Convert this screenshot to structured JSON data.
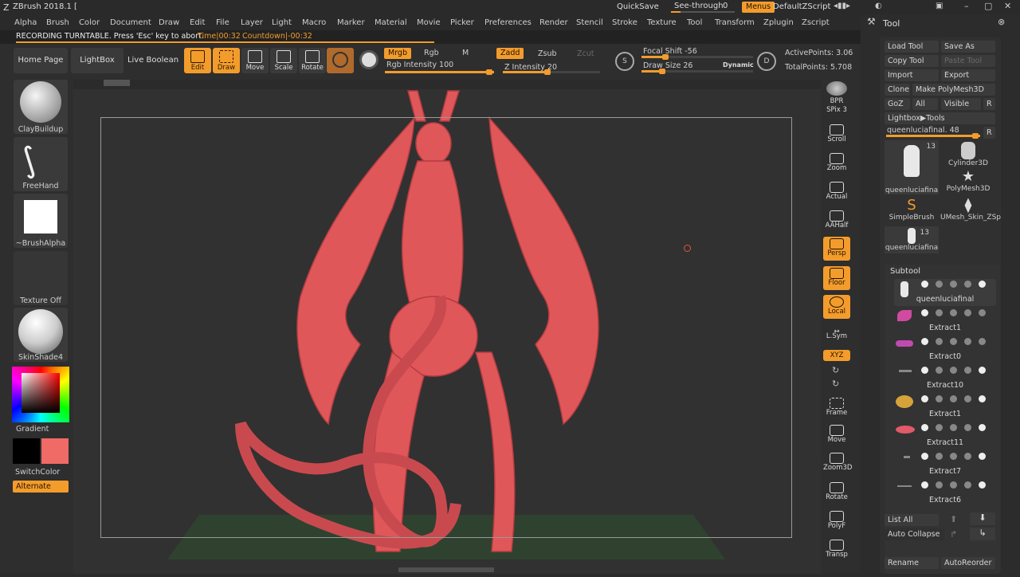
{
  "title_bar": {
    "app_title": "ZBrush 2018.1 [",
    "quicksave": "QuickSave",
    "see_through_label": "See-through",
    "see_through_value": "0",
    "menus": "Menus",
    "zscript": "DefaultZScript"
  },
  "menu": [
    "Alpha",
    "Brush",
    "Color",
    "Document",
    "Draw",
    "Edit",
    "File",
    "Layer",
    "Light",
    "Macro",
    "Marker",
    "Material",
    "Movie",
    "Picker",
    "Preferences",
    "Render",
    "Stencil",
    "Stroke",
    "Texture",
    "Tool",
    "Transform",
    "Zplugin",
    "Zscript"
  ],
  "recording": {
    "message": "RECORDING TURNTABLE. Press 'Esc' key to abort.",
    "time": "Time|00:32",
    "countdown": "Countdown|-00:32"
  },
  "shelf": {
    "home": "Home Page",
    "lightbox": "LightBox",
    "live_boolean": "Live Boolean",
    "tools": [
      {
        "label": "Edit",
        "on": true
      },
      {
        "label": "Draw",
        "on": true
      },
      {
        "label": "Move",
        "on": false
      },
      {
        "label": "Scale",
        "on": false
      },
      {
        "label": "Rotate",
        "on": false
      }
    ],
    "mrgb": "Mrgb",
    "rgb": "Rgb",
    "m": "M",
    "rgb_intensity": "Rgb Intensity 100",
    "zadd": "Zadd",
    "zsub": "Zsub",
    "zcut": "Zcut",
    "z_intensity": "Z Intensity 20",
    "focal_shift": "Focal Shift -56",
    "draw_size": "Draw Size 26",
    "dynamic": "Dynamic",
    "active_points": "ActivePoints: 3.06",
    "total_points": "TotalPoints: 5.708",
    "rgb_intensity_pct": 1.0,
    "z_intensity_pct": 0.2,
    "focal_shift_pct": 0.22,
    "draw_size_pct": 0.2
  },
  "left": {
    "brush1": "ClayBuildup",
    "brush2": "FreeHand",
    "alpha": "~BrushAlpha",
    "texture": "Texture Off",
    "material": "SkinShade4",
    "gradient": "Gradient",
    "switch_color": "SwitchColor",
    "alternate": "Alternate"
  },
  "right_shelf": [
    {
      "label": "BPR",
      "on": false
    },
    {
      "label": "SPix 3",
      "on": false
    },
    {
      "label": "Scroll",
      "on": false
    },
    {
      "label": "Zoom",
      "on": false
    },
    {
      "label": "Actual",
      "on": false
    },
    {
      "label": "AAHalf",
      "on": false
    },
    {
      "label": "Persp",
      "on": true
    },
    {
      "label": "Floor",
      "on": true
    },
    {
      "label": "Local",
      "on": true
    },
    {
      "label": "L.Sym",
      "on": false
    },
    {
      "label": "XYZ",
      "on": true
    },
    {
      "label": "Frame",
      "on": false
    },
    {
      "label": "Move",
      "on": false
    },
    {
      "label": "Zoom3D",
      "on": false
    },
    {
      "label": "Rotate",
      "on": false
    },
    {
      "label": "PolyF",
      "on": false
    },
    {
      "label": "Transp",
      "on": false
    }
  ],
  "tool_panel": {
    "title": "Tool",
    "load_tool": "Load Tool",
    "save_as": "Save As",
    "copy_tool": "Copy Tool",
    "paste_tool": "Paste Tool",
    "import": "Import",
    "export": "Export",
    "clone": "Clone",
    "make_polymesh": "Make PolyMesh3D",
    "goz": "GoZ",
    "all": "All",
    "visible": "Visible",
    "r": "R",
    "lightbox_tools": "Lightbox▶Tools",
    "current_tool": "queenluciafinal. 48",
    "thumbs": [
      {
        "name": "queenluciafina",
        "count": "13"
      },
      {
        "name": "Cylinder3D",
        "count": ""
      },
      {
        "name": "PolyMesh3D",
        "count": ""
      },
      {
        "name": "SimpleBrush",
        "count": ""
      },
      {
        "name": "UMesh_Skin_ZSp",
        "count": ""
      },
      {
        "name": "queenluciafina",
        "count": "13"
      }
    ],
    "subtool_title": "Subtool",
    "subtools": [
      "queenluciafinal",
      "Extract1",
      "Extract0",
      "Extract10",
      "Extract1",
      "Extract11",
      "Extract7",
      "Extract6"
    ],
    "list_all": "List All",
    "auto_collapse": "Auto Collapse",
    "rename": "Rename",
    "auto_reorder": "AutoReorder"
  },
  "colors": {
    "accent": "#f39c2c",
    "model": "#e0575a",
    "secondary_color": "#f06a66"
  }
}
